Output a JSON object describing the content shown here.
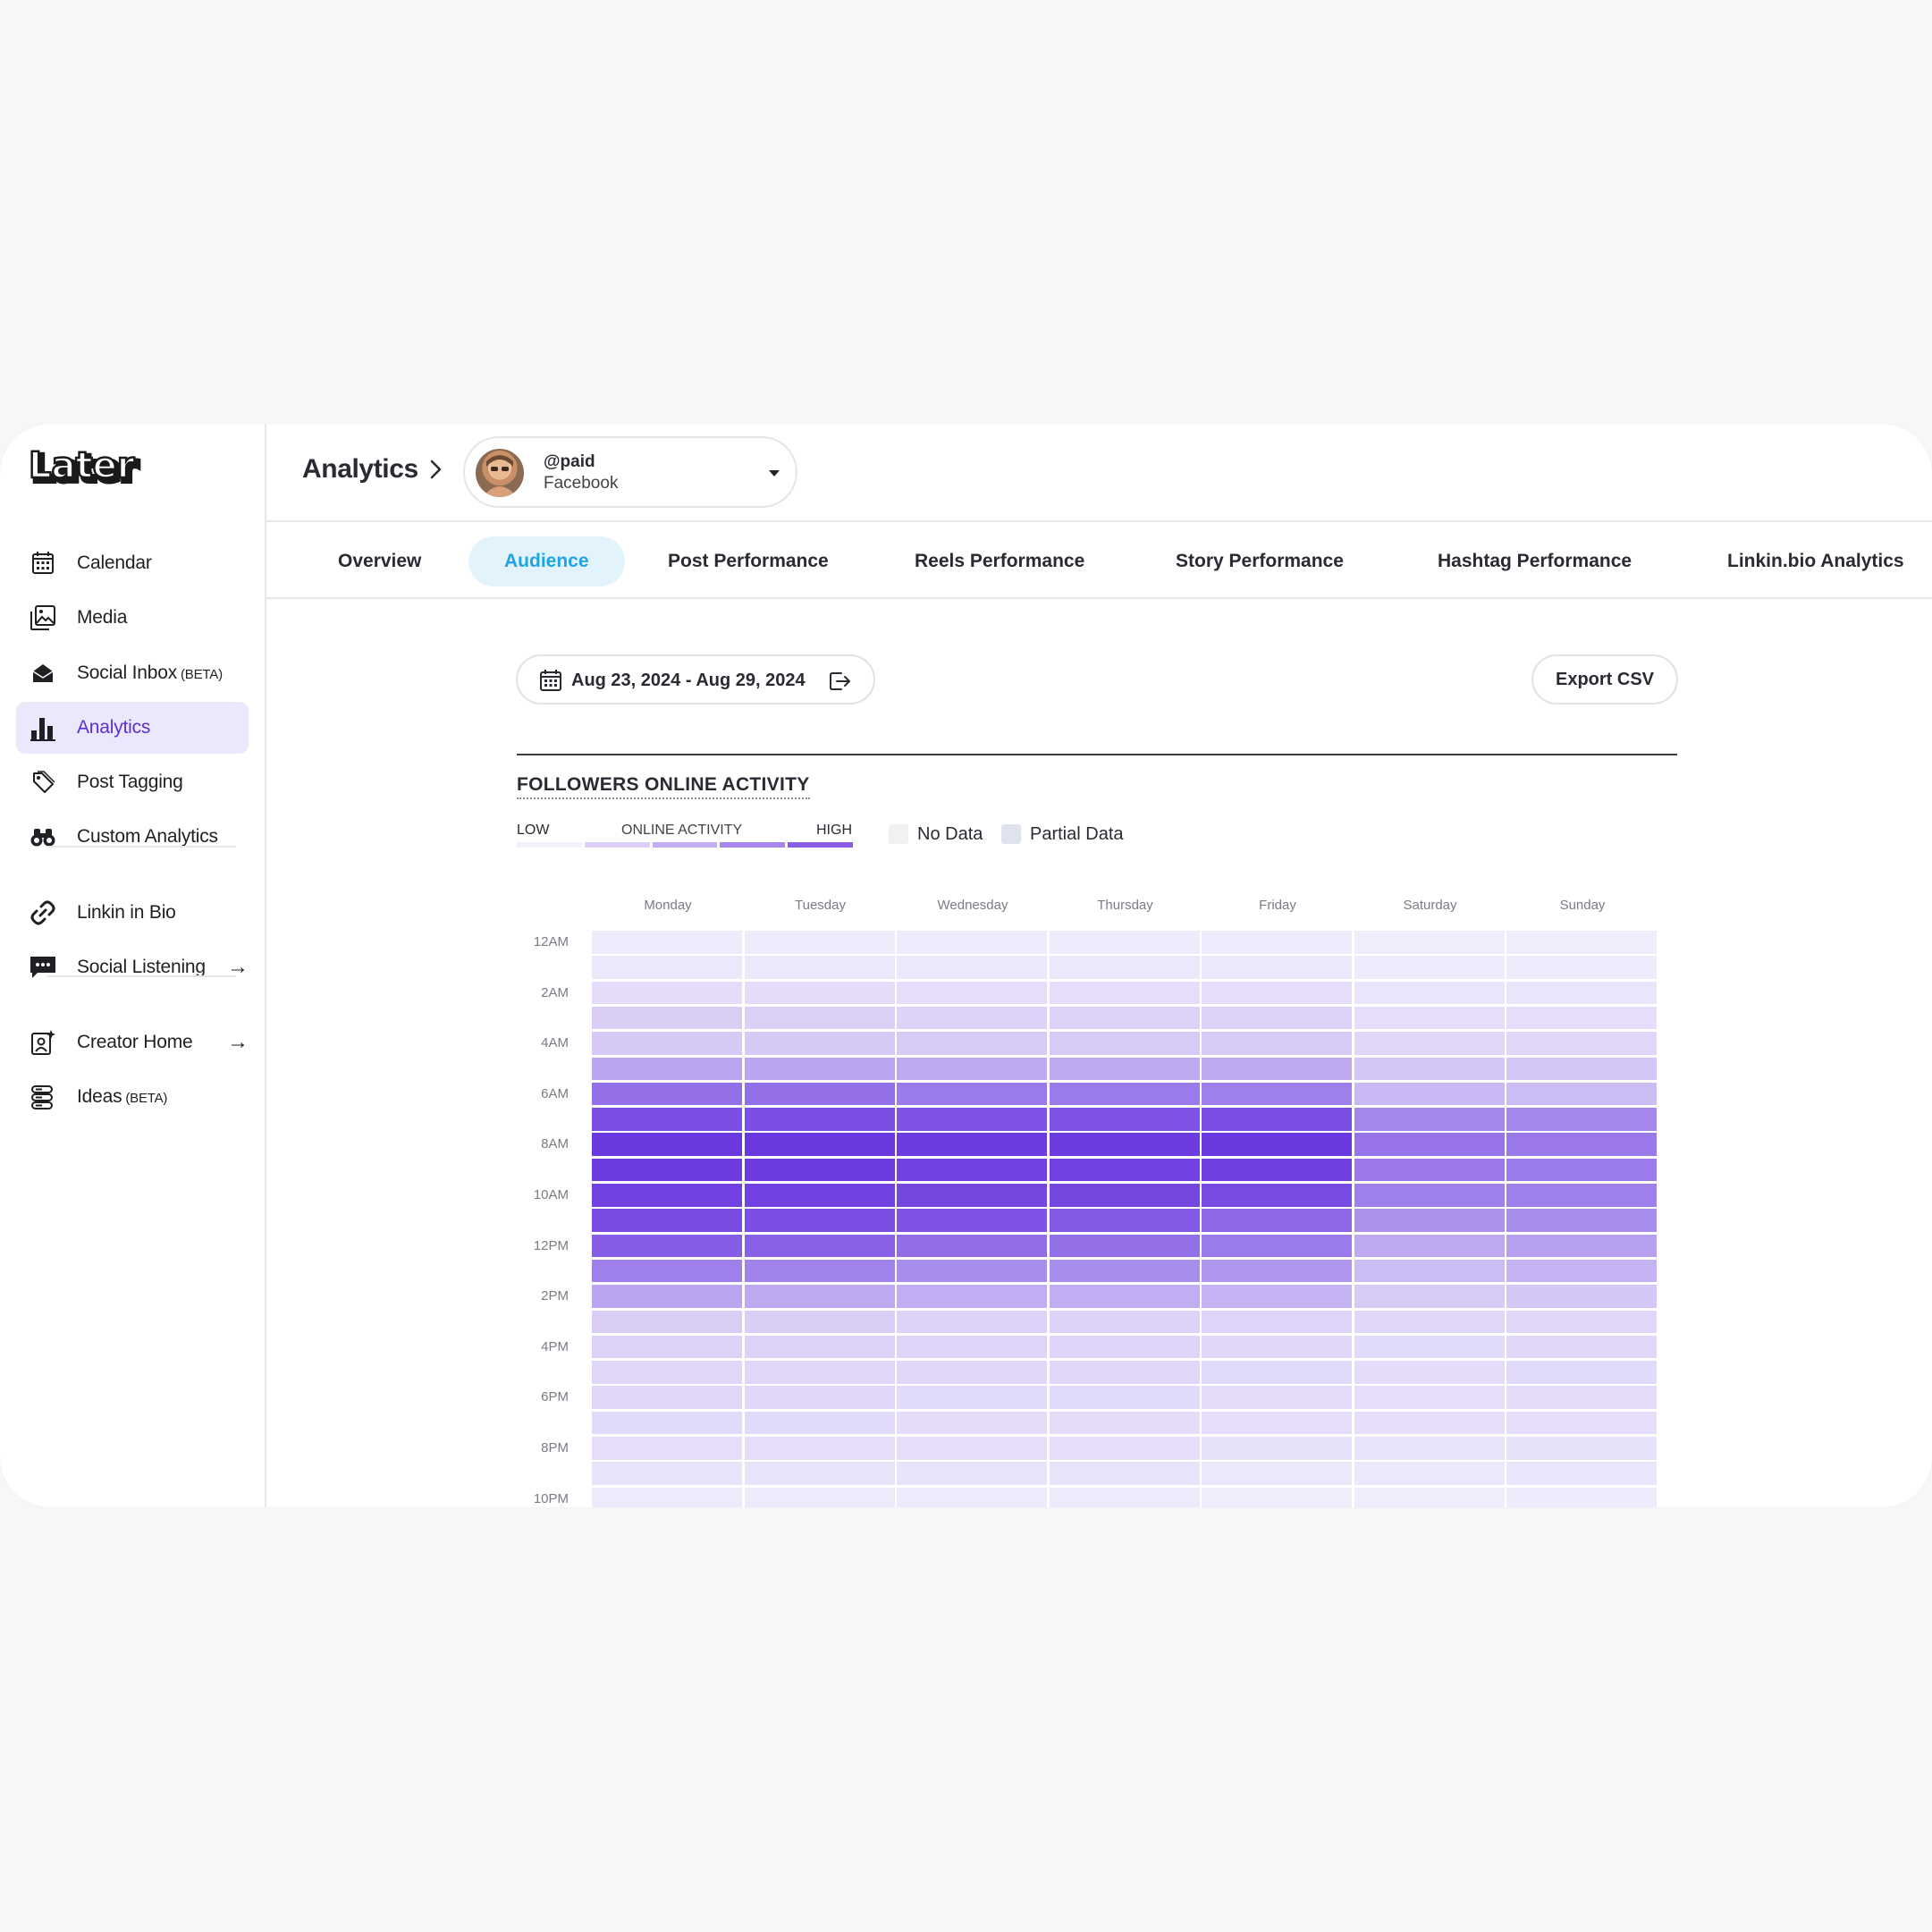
{
  "app": {
    "logo_text": "Later"
  },
  "sidebar": {
    "items": [
      {
        "label": "Calendar",
        "icon": "calendar-icon",
        "tag": "",
        "arrow": ""
      },
      {
        "label": "Media",
        "icon": "image-icon",
        "tag": "",
        "arrow": ""
      },
      {
        "label": "Social Inbox",
        "icon": "inbox-icon",
        "tag": "(BETA)",
        "arrow": ""
      },
      {
        "label": "Analytics",
        "icon": "bar-chart-icon",
        "tag": "",
        "arrow": "",
        "active": true
      },
      {
        "label": "Post Tagging",
        "icon": "tag-icon",
        "tag": "",
        "arrow": ""
      },
      {
        "label": "Custom Analytics",
        "icon": "binoculars-icon",
        "tag": "",
        "arrow": ""
      },
      {
        "label": "Linkin in Bio",
        "icon": "link-icon",
        "tag": "",
        "arrow": ""
      },
      {
        "label": "Social Listening",
        "icon": "chat-icon",
        "tag": "",
        "arrow": "→"
      },
      {
        "label": "Creator Home",
        "icon": "creator-icon",
        "tag": "",
        "arrow": "→"
      },
      {
        "label": "Ideas",
        "icon": "ideas-icon",
        "tag": "(BETA)",
        "arrow": ""
      }
    ]
  },
  "header": {
    "breadcrumb": "Analytics",
    "account": {
      "handle": "@paid",
      "network": "Facebook"
    }
  },
  "tabs": [
    {
      "label": "Overview"
    },
    {
      "label": "Audience",
      "active": true
    },
    {
      "label": "Post Performance"
    },
    {
      "label": "Reels Performance"
    },
    {
      "label": "Story Performance"
    },
    {
      "label": "Hashtag Performance"
    },
    {
      "label": "Linkin.bio Analytics"
    }
  ],
  "toolbar": {
    "date_range": "Aug 23, 2024 - Aug 29, 2024",
    "export_label": "Export CSV"
  },
  "section": {
    "title": "FOLLOWERS ONLINE ACTIVITY",
    "legend": {
      "low": "LOW",
      "mid": "ONLINE ACTIVITY",
      "high": "HIGH",
      "no_data": "No Data",
      "partial_data": "Partial Data"
    }
  },
  "colors": {
    "accent": "#5b2fd6",
    "tab_active_bg": "#e2f3fc",
    "tab_active_text": "#1fa3e3",
    "heat_low": "#f6f4fd",
    "heat_high": "#6a38df"
  },
  "chart_data": {
    "type": "heatmap",
    "title": "FOLLOWERS ONLINE ACTIVITY",
    "x": [
      "Monday",
      "Tuesday",
      "Wednesday",
      "Thursday",
      "Friday",
      "Saturday",
      "Sunday"
    ],
    "y_labels": [
      "12AM",
      "2AM",
      "4AM",
      "6AM",
      "8AM",
      "10AM",
      "12PM",
      "2PM",
      "4PM",
      "6PM",
      "8PM",
      "10PM"
    ],
    "hours": 23,
    "values": [
      [
        0.05,
        0.05,
        0.05,
        0.05,
        0.05,
        0.04,
        0.04
      ],
      [
        0.07,
        0.07,
        0.07,
        0.07,
        0.07,
        0.05,
        0.05
      ],
      [
        0.13,
        0.13,
        0.12,
        0.12,
        0.12,
        0.08,
        0.08
      ],
      [
        0.2,
        0.19,
        0.18,
        0.18,
        0.18,
        0.12,
        0.12
      ],
      [
        0.23,
        0.23,
        0.22,
        0.22,
        0.22,
        0.16,
        0.16
      ],
      [
        0.42,
        0.42,
        0.4,
        0.4,
        0.4,
        0.25,
        0.25
      ],
      [
        0.7,
        0.7,
        0.65,
        0.65,
        0.62,
        0.32,
        0.3
      ],
      [
        0.88,
        0.88,
        0.85,
        0.86,
        0.88,
        0.58,
        0.58
      ],
      [
        1.0,
        1.0,
        0.98,
        0.98,
        1.0,
        0.68,
        0.66
      ],
      [
        0.98,
        0.98,
        0.95,
        0.95,
        0.96,
        0.66,
        0.64
      ],
      [
        0.95,
        0.95,
        0.92,
        0.92,
        0.9,
        0.62,
        0.62
      ],
      [
        0.9,
        0.88,
        0.85,
        0.82,
        0.75,
        0.52,
        0.55
      ],
      [
        0.8,
        0.78,
        0.72,
        0.7,
        0.65,
        0.4,
        0.45
      ],
      [
        0.62,
        0.6,
        0.55,
        0.55,
        0.5,
        0.3,
        0.35
      ],
      [
        0.42,
        0.4,
        0.38,
        0.38,
        0.35,
        0.22,
        0.24
      ],
      [
        0.2,
        0.2,
        0.18,
        0.18,
        0.17,
        0.15,
        0.16
      ],
      [
        0.18,
        0.18,
        0.17,
        0.17,
        0.16,
        0.14,
        0.15
      ],
      [
        0.16,
        0.16,
        0.15,
        0.15,
        0.14,
        0.13,
        0.14
      ],
      [
        0.15,
        0.15,
        0.14,
        0.14,
        0.13,
        0.12,
        0.13
      ],
      [
        0.14,
        0.14,
        0.13,
        0.13,
        0.12,
        0.11,
        0.12
      ],
      [
        0.12,
        0.12,
        0.11,
        0.11,
        0.1,
        0.09,
        0.1
      ],
      [
        0.09,
        0.09,
        0.09,
        0.09,
        0.07,
        0.07,
        0.08
      ],
      [
        0.06,
        0.06,
        0.06,
        0.06,
        0.04,
        0.04,
        0.05
      ]
    ]
  }
}
